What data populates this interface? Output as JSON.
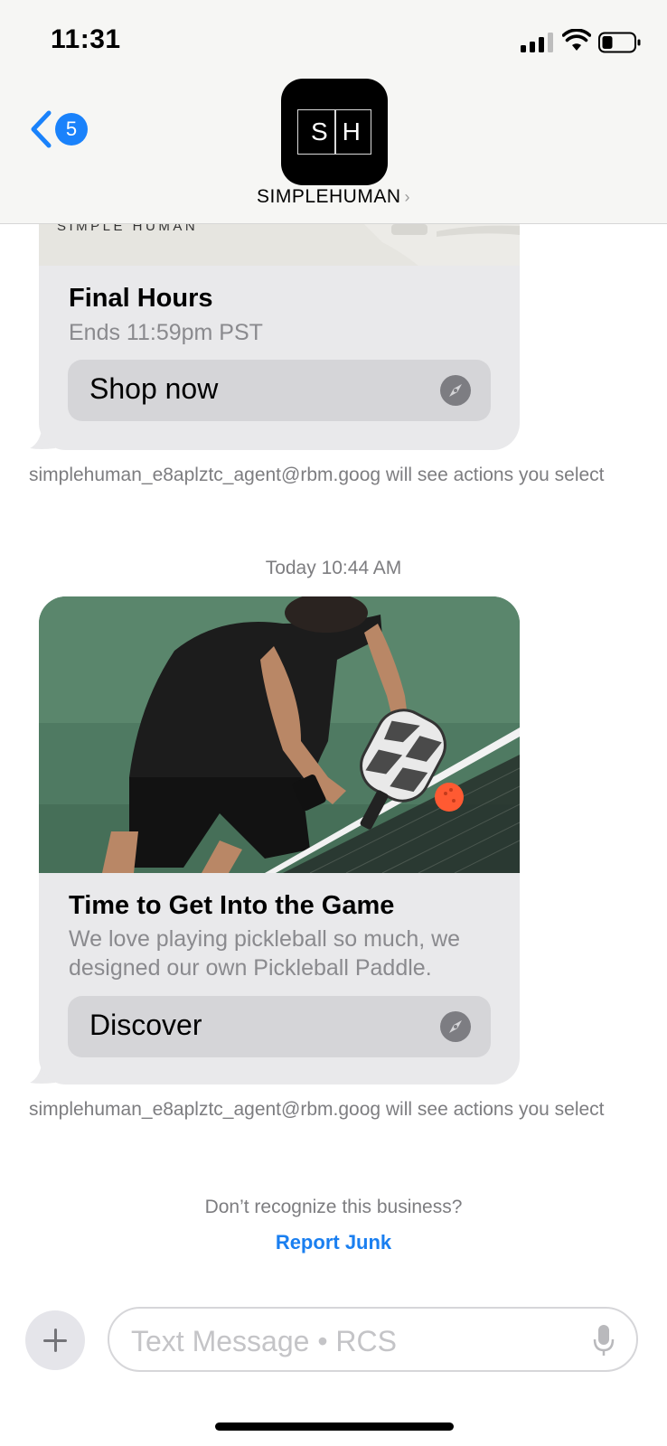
{
  "status_bar": {
    "time": "11:31",
    "icons": [
      "cellular-signal-icon",
      "wifi-icon",
      "battery-icon"
    ]
  },
  "header": {
    "back_badge_count": "5",
    "avatar_monogram": "SH",
    "contact_name": "SIMPLEHUMAN",
    "contact_chevron": "›"
  },
  "messages": [
    {
      "banner_text": "SIMPLE HUMAN",
      "title": "Final Hours",
      "description": "Ends 11:59pm PST",
      "action_label": "Shop now",
      "action_icon": "compass-icon",
      "actions_note": "simplehuman_e8aplztc_agent@rbm.goog will see actions you select"
    },
    {
      "image": "pickleball-player-photo",
      "title": "Time to Get Into the Game",
      "description": "We love playing pickleball so much, we designed our own Pickleball Paddle.",
      "action_label": "Discover",
      "action_icon": "compass-icon",
      "actions_note": "simplehuman_e8aplztc_agent@rbm.goog will see actions you select"
    }
  ],
  "timestamp": {
    "day": "Today",
    "time": "10:44 AM"
  },
  "footer": {
    "dont_recognize": "Don’t recognize this business?",
    "report_junk": "Report Junk"
  },
  "composer": {
    "placeholder": "Text Message • RCS"
  },
  "colors": {
    "accent_blue": "#1a82fb",
    "bubble_gray": "#e9e9eb",
    "button_gray": "#d5d5d8",
    "secondary_text": "#7d7d80"
  }
}
